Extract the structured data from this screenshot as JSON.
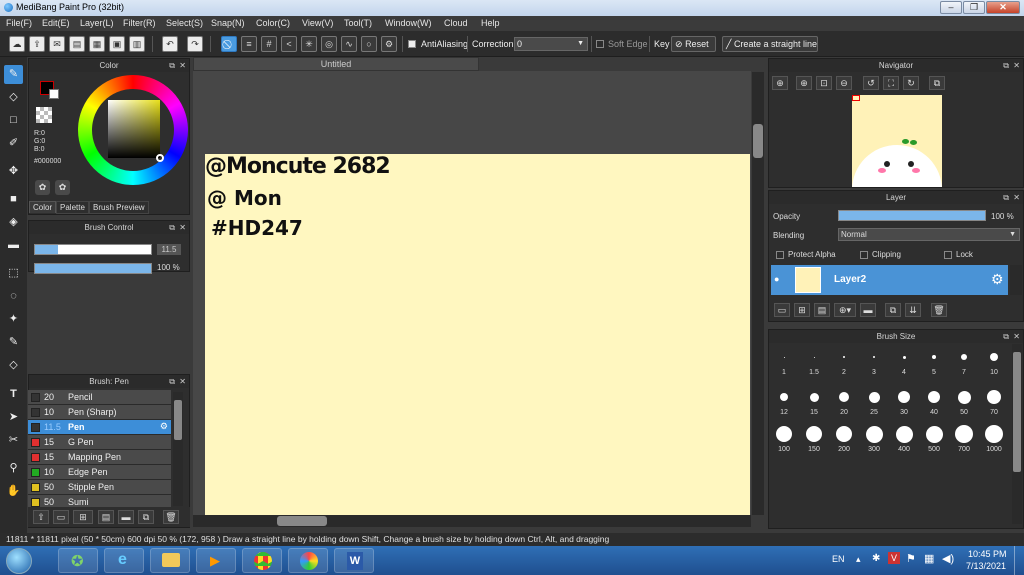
{
  "app": {
    "title": "MediBang Paint Pro (32bit)"
  },
  "menu": [
    "File(F)",
    "Edit(E)",
    "Layer(L)",
    "Filter(R)",
    "Select(S)",
    "Snap(N)",
    "Color(C)",
    "View(V)",
    "Tool(T)",
    "Window(W)",
    "Cloud",
    "Help"
  ],
  "toolbar": {
    "antialiasing_label": "AntiAliasing",
    "correction_label": "Correction",
    "correction_value": "0",
    "soft_edge_label": "Soft Edge",
    "key_label": "Key",
    "reset_label": "Reset",
    "straight_line_label": "Create a straight line"
  },
  "color_panel": {
    "title": "Color",
    "r": "R:0",
    "g": "G:0",
    "b": "B:0",
    "hex": "#000000",
    "tabs": [
      "Color",
      "Palette",
      "Brush Preview"
    ],
    "primary_color": "#000000",
    "secondary_color": "#ffffff"
  },
  "brush_control": {
    "title": "Brush Control",
    "size_value": "11.5",
    "opacity_value": "100 %",
    "size_fraction": 0.12,
    "opacity_fraction": 1.0
  },
  "brush_list": {
    "title": "Brush: Pen",
    "items": [
      {
        "size": "20",
        "name": "Pencil",
        "color": "#333333"
      },
      {
        "size": "10",
        "name": "Pen (Sharp)",
        "color": "#333333"
      },
      {
        "size": "11.5",
        "name": "Pen",
        "color": "#333333"
      },
      {
        "size": "15",
        "name": "G Pen",
        "color": "#e03030"
      },
      {
        "size": "15",
        "name": "Mapping Pen",
        "color": "#e03030"
      },
      {
        "size": "10",
        "name": "Edge Pen",
        "color": "#22aa22"
      },
      {
        "size": "50",
        "name": "Stipple Pen",
        "color": "#e0c020"
      },
      {
        "size": "50",
        "name": "Sumi",
        "color": "#e0c020"
      }
    ]
  },
  "document": {
    "title": "Untitled"
  },
  "canvas_text": {
    "line1": "@Moncute 2682",
    "line2": "@ Mon",
    "line3": "#HD247"
  },
  "navigator": {
    "title": "Navigator"
  },
  "layer_panel": {
    "title": "Layer",
    "opacity_label": "Opacity",
    "opacity_value": "100 %",
    "opacity_fraction": 1.0,
    "blending_label": "Blending",
    "blending_value": "Normal",
    "protect_alpha": "Protect Alpha",
    "clipping": "Clipping",
    "lock": "Lock",
    "layer_name": "Layer2"
  },
  "brush_size": {
    "title": "Brush Size",
    "row1": [
      "1",
      "1.5",
      "2",
      "3",
      "4",
      "5",
      "7",
      "10"
    ],
    "row2": [
      "12",
      "15",
      "20",
      "25",
      "30",
      "40",
      "50",
      "70"
    ],
    "row3": [
      "100",
      "150",
      "200",
      "300",
      "400",
      "500",
      "700",
      "1000"
    ]
  },
  "status": {
    "text": "11811 * 11811 pixel   (50 * 50cm)   600 dpi   50 %   (172, 958 )   Draw a straight line by holding down Shift, Change a brush size by holding down Ctrl, Alt, and dragging"
  },
  "taskbar": {
    "lang": "EN",
    "time": "10:45 PM",
    "date": "7/13/2021"
  }
}
